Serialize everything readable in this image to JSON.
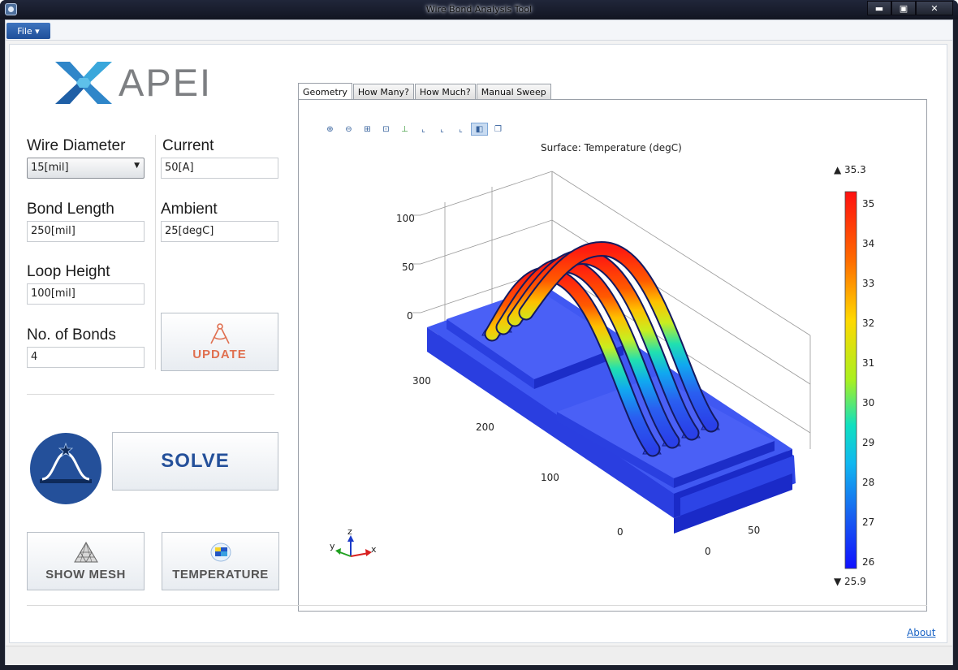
{
  "window": {
    "title": "Wire Bond Analysis Tool",
    "minimize": "▬",
    "maximize": "▣",
    "close": "✕"
  },
  "menu": {
    "file": "File ▾"
  },
  "logo": {
    "text": "APEI"
  },
  "form": {
    "wire_diameter": {
      "label": "Wire Diameter",
      "value": "15[mil]"
    },
    "current": {
      "label": "Current",
      "value": "50[A]"
    },
    "bond_length": {
      "label": "Bond Length",
      "value": "250[mil]"
    },
    "ambient": {
      "label": "Ambient",
      "value": "25[degC]"
    },
    "loop_height": {
      "label": "Loop Height",
      "value": "100[mil]"
    },
    "num_bonds": {
      "label": "No. of Bonds",
      "value": "4"
    }
  },
  "buttons": {
    "update": "UPDATE",
    "solve": "SOLVE",
    "show_mesh": "SHOW MESH",
    "temperature": "TEMPERATURE"
  },
  "tabs": [
    {
      "label": "Geometry",
      "active": true
    },
    {
      "label": "How Many?",
      "active": false
    },
    {
      "label": "How Much?",
      "active": false
    },
    {
      "label": "Manual Sweep",
      "active": false
    }
  ],
  "toolbar_icons": [
    "zoom-in-icon",
    "zoom-out-icon",
    "zoom-box-icon",
    "zoom-extents-icon",
    "axes-icon",
    "xy-view-icon",
    "yz-view-icon",
    "zx-view-icon",
    "transparency-icon",
    "scene-light-icon"
  ],
  "plot": {
    "title": "Surface: Temperature (degC)",
    "max_label": "▲ 35.3",
    "min_label": "▼ 25.9",
    "colorbar_ticks": [
      "35",
      "34",
      "33",
      "32",
      "31",
      "30",
      "29",
      "28",
      "27",
      "26"
    ],
    "z_ticks": [
      "100",
      "50",
      "0"
    ],
    "y_ticks": [
      "300",
      "200",
      "100",
      "0"
    ],
    "x_ticks": [
      "50",
      "0"
    ],
    "axis_x": "x",
    "axis_y": "y",
    "axis_z": "z"
  },
  "about": "About",
  "colors": {
    "accent": "#24509a",
    "update": "#e07050",
    "link": "#1a63c5",
    "board": "#3348e8"
  }
}
